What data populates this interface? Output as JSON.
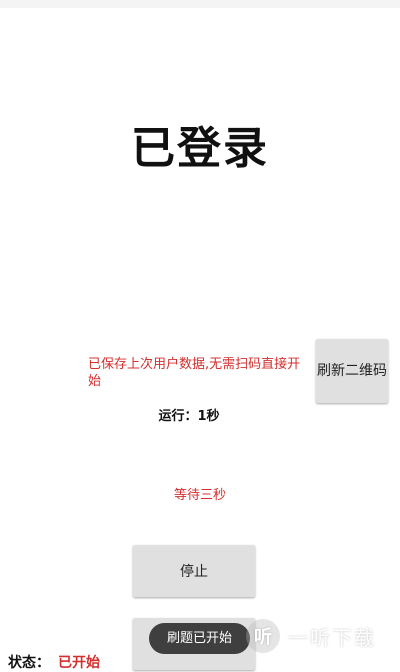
{
  "title": "已登录",
  "saved_msg": "已保存上次用户数据,无需扫码直接开始",
  "refresh_button": "刷新二维码",
  "run_time": "运行：1秒",
  "wait_msg": "等待三秒",
  "stop_button": "停止",
  "status": {
    "label": "状态：",
    "value": "已开始"
  },
  "toast": "刷题已开始",
  "watermark": {
    "icon": "听",
    "text": "一听下载"
  },
  "colors": {
    "accent_red": "#d32f2f",
    "button_bg": "#e0e0e0"
  }
}
